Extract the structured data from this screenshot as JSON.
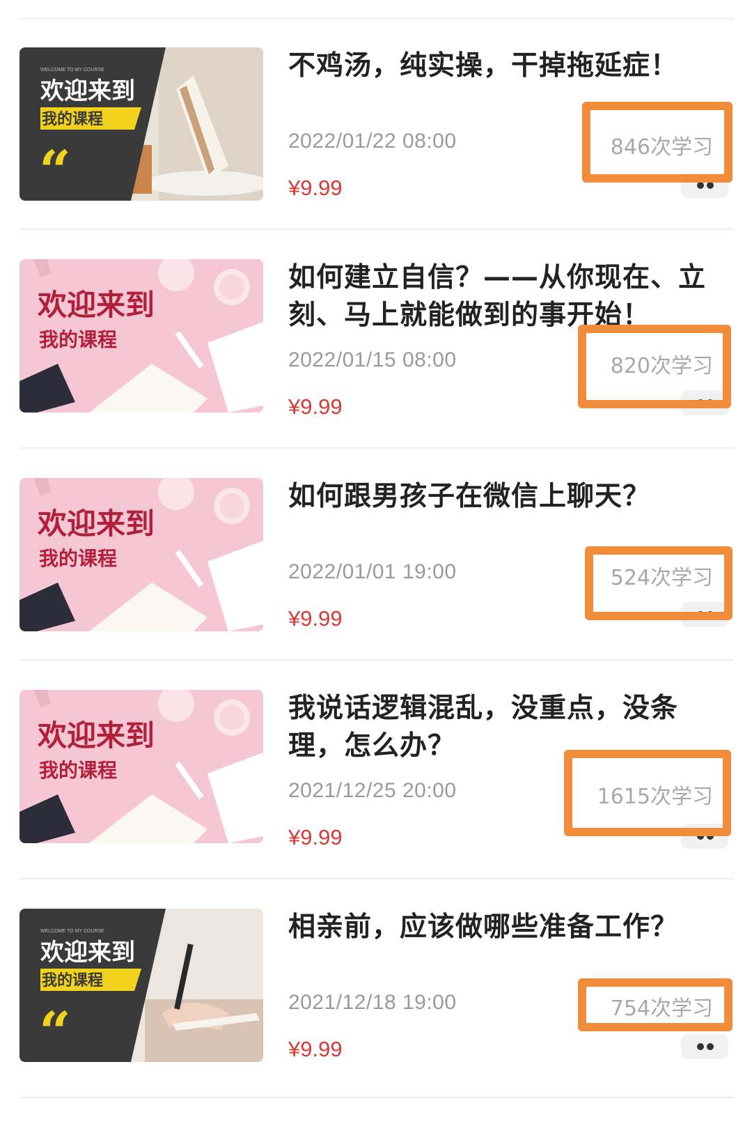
{
  "courses": [
    {
      "title": "不鸡汤，纯实操，干掉拖延症！",
      "date": "2022/01/22 08:00",
      "study_count": "846次学习",
      "price": "¥9.99",
      "thumbnail": {
        "style": "dark",
        "heading": "欢迎来到",
        "sub": "我的课程",
        "tiny": "WELCOME TO MY COURSE",
        "quote": "“"
      }
    },
    {
      "title": "如何建立自信？——从你现在、立刻、马上就能做到的事开始！",
      "date": "2022/01/15 08:00",
      "study_count": "820次学习",
      "price": "¥9.99",
      "thumbnail": {
        "style": "pink",
        "heading": "欢迎来到",
        "sub": "我的课程"
      }
    },
    {
      "title": "如何跟男孩子在微信上聊天？",
      "date": "2022/01/01 19:00",
      "study_count": "524次学习",
      "price": "¥9.99",
      "thumbnail": {
        "style": "pink",
        "heading": "欢迎来到",
        "sub": "我的课程"
      }
    },
    {
      "title": "我说话逻辑混乱，没重点，没条理，怎么办？",
      "date": "2021/12/25 20:00",
      "study_count": "1615次学习",
      "price": "¥9.99",
      "thumbnail": {
        "style": "pink",
        "heading": "欢迎来到",
        "sub": "我的课程"
      }
    },
    {
      "title": "相亲前，应该做哪些准备工作？",
      "date": "2021/12/18 19:00",
      "study_count": "754次学习",
      "price": "¥9.99",
      "thumbnail": {
        "style": "dark",
        "heading": "欢迎来到",
        "sub": "我的课程",
        "tiny": "WELCOME TO MY COURSE",
        "quote": "“"
      }
    }
  ],
  "colors": {
    "highlight": "#f08c3a",
    "price": "#d83a34",
    "meta": "#9a9a9a",
    "title": "#222222",
    "pink_bg": "#f5c6d3",
    "dark_bg": "#3a3a3a",
    "yellow": "#f3d21e"
  },
  "icons": {
    "more": "more-dots-icon",
    "quote": "quote-mark-icon"
  }
}
